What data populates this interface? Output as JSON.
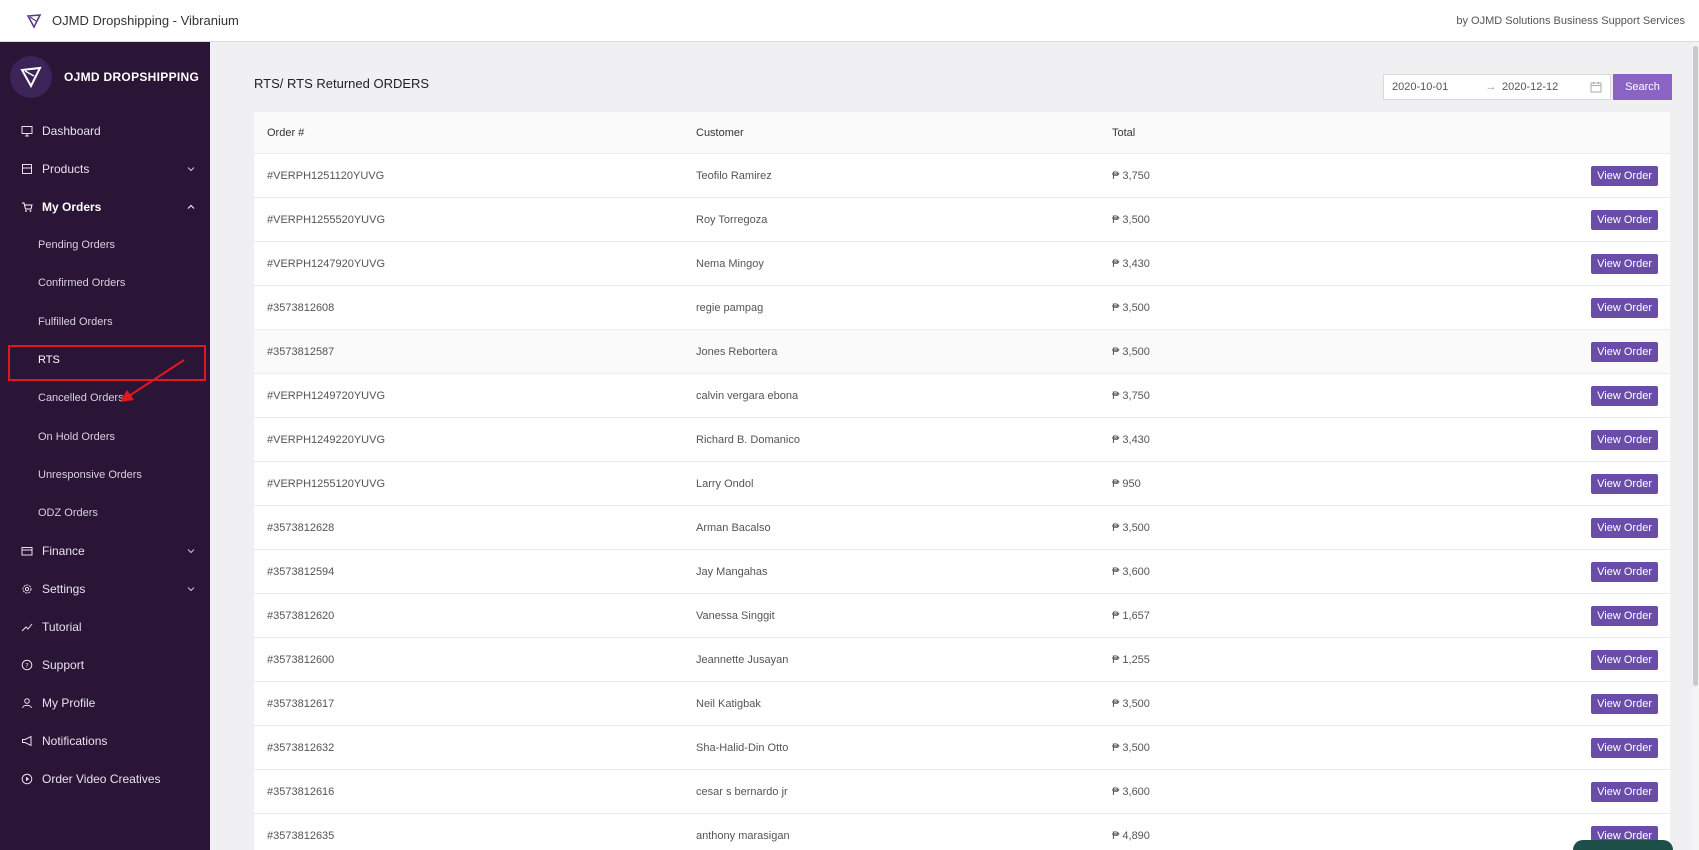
{
  "topbar": {
    "title": "OJMD Dropshipping - Vibranium",
    "credit": "by OJMD Solutions Business Support Services"
  },
  "sidebar": {
    "brand": "OJMD DROPSHIPPING",
    "items": [
      {
        "label": "Dashboard",
        "icon": "monitor-icon"
      },
      {
        "label": "Products",
        "icon": "store-icon"
      },
      {
        "label": "My Orders",
        "icon": "cart-icon"
      },
      {
        "label": "Finance",
        "icon": "wallet-icon"
      },
      {
        "label": "Settings",
        "icon": "gear-icon"
      },
      {
        "label": "Tutorial",
        "icon": "trend-icon"
      },
      {
        "label": "Support",
        "icon": "help-icon"
      },
      {
        "label": "My Profile",
        "icon": "user-icon"
      },
      {
        "label": "Notifications",
        "icon": "megaphone-icon"
      },
      {
        "label": "Order Video Creatives",
        "icon": "play-icon"
      }
    ],
    "order_sub": [
      "Pending Orders",
      "Confirmed Orders",
      "Fulfilled Orders",
      "RTS",
      "Cancelled Orders",
      "On Hold Orders",
      "Unresponsive Orders",
      "ODZ Orders"
    ]
  },
  "main": {
    "title": "RTS/ RTS Returned ORDERS",
    "date_from": "2020-10-01",
    "date_to": "2020-12-12",
    "date_sep": "→",
    "search_label": "Search",
    "columns": {
      "order": "Order #",
      "customer": "Customer",
      "total": "Total"
    },
    "view_label": "View Order",
    "rows": [
      {
        "order": "#VERPH1251120YUVG",
        "customer": "Teofilo Ramirez",
        "total": "₱ 3,750"
      },
      {
        "order": "#VERPH1255520YUVG",
        "customer": "Roy Torregoza",
        "total": "₱ 3,500"
      },
      {
        "order": "#VERPH1247920YUVG",
        "customer": "Nema Mingoy",
        "total": "₱ 3,430"
      },
      {
        "order": "#3573812608",
        "customer": "regie pampag",
        "total": "₱ 3,500"
      },
      {
        "order": "#3573812587",
        "customer": "Jones Rebortera",
        "total": "₱ 3,500"
      },
      {
        "order": "#VERPH1249720YUVG",
        "customer": "calvin vergara ebona",
        "total": "₱ 3,750"
      },
      {
        "order": "#VERPH1249220YUVG",
        "customer": "Richard B. Domanico",
        "total": "₱ 3,430"
      },
      {
        "order": "#VERPH1255120YUVG",
        "customer": "Larry Ondol",
        "total": "₱ 950"
      },
      {
        "order": "#3573812628",
        "customer": "Arman Bacalso",
        "total": "₱ 3,500"
      },
      {
        "order": "#3573812594",
        "customer": "Jay Mangahas",
        "total": "₱ 3,600"
      },
      {
        "order": "#3573812620",
        "customer": "Vanessa Singgit",
        "total": "₱ 1,657"
      },
      {
        "order": "#3573812600",
        "customer": "Jeannette Jusayan",
        "total": "₱ 1,255"
      },
      {
        "order": "#3573812617",
        "customer": "Neil Katigbak",
        "total": "₱ 3,500"
      },
      {
        "order": "#3573812632",
        "customer": "Sha-Halid-Din Otto",
        "total": "₱ 3,500"
      },
      {
        "order": "#3573812616",
        "customer": "cesar s bernardo jr",
        "total": "₱ 3,600"
      },
      {
        "order": "#3573812635",
        "customer": "anthony marasigan",
        "total": "₱ 4,890"
      }
    ]
  },
  "colors": {
    "sidebar": "#2a1536",
    "accent": "#6a4da8",
    "search": "#8a63c4",
    "annotation": "#e0191f"
  }
}
